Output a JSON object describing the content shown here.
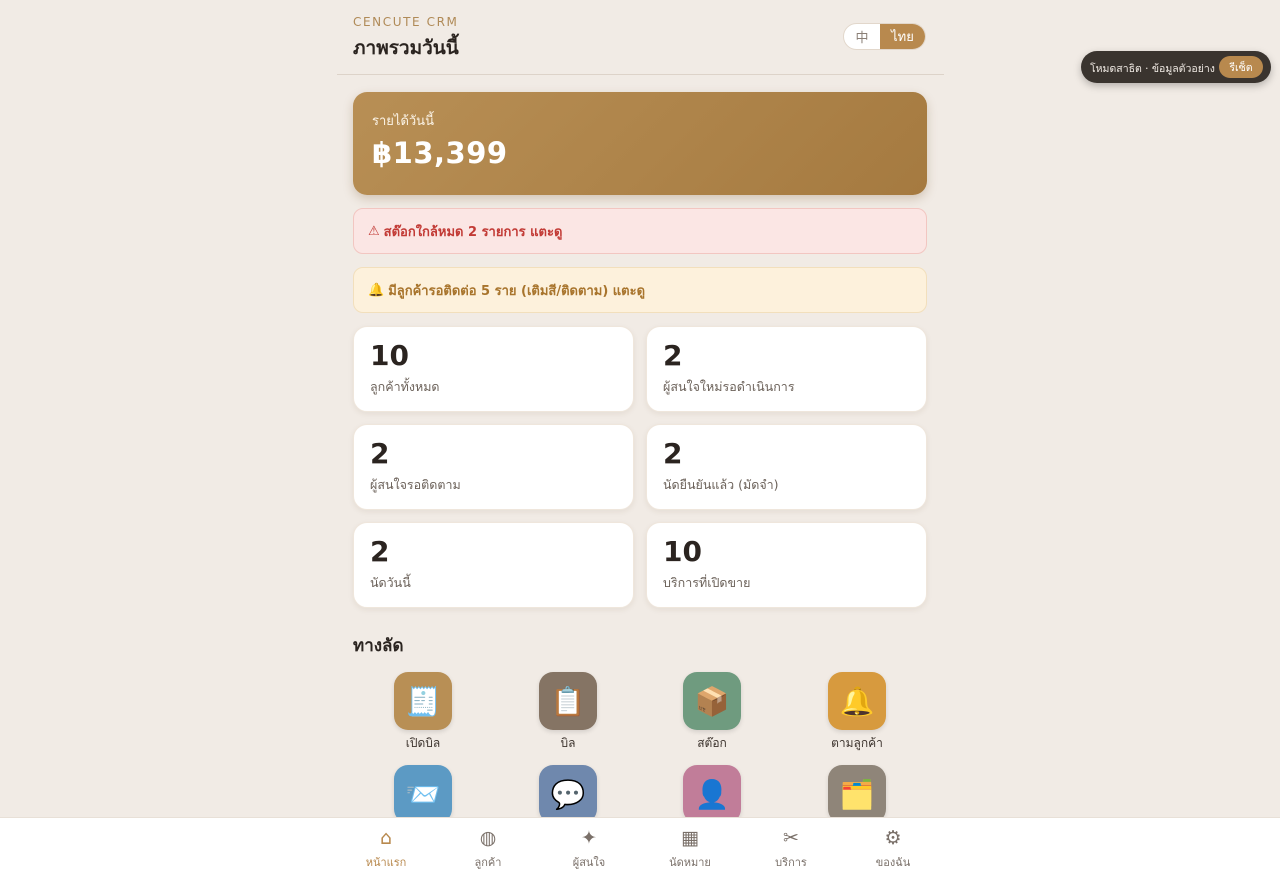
{
  "header": {
    "brand": "CENCUTE CRM",
    "title": "ภาพรวมวันนี้",
    "lang_options": [
      "中",
      "ไทย"
    ],
    "lang_active": "ไทย"
  },
  "revenue": {
    "label": "รายได้วันนี้",
    "value": "฿13,399"
  },
  "alerts": {
    "stock": {
      "icon": "⚠",
      "text": "สต๊อกใกล้หมด 2 รายการ แตะดู"
    },
    "follow": {
      "icon": "🔔",
      "text": "มีลูกค้ารอติดต่อ 5 ราย (เติมสี/ติดตาม) แตะดู"
    }
  },
  "stats": [
    {
      "value": "10",
      "label": "ลูกค้าทั้งหมด"
    },
    {
      "value": "2",
      "label": "ผู้สนใจใหม่รอดำเนินการ"
    },
    {
      "value": "2",
      "label": "ผู้สนใจรอติดตาม"
    },
    {
      "value": "2",
      "label": "นัดยืนยันแล้ว (มัดจำ)"
    },
    {
      "value": "2",
      "label": "นัดวันนี้"
    },
    {
      "value": "10",
      "label": "บริการที่เปิดขาย"
    }
  ],
  "shortcuts": {
    "title": "ทางลัด",
    "items": [
      {
        "label": "เปิดบิล",
        "icon": "receipt-icon",
        "glyph": "🧾",
        "color": "#b88f55"
      },
      {
        "label": "บิล",
        "icon": "clipboard-icon",
        "glyph": "📋",
        "color": "#857464"
      },
      {
        "label": "สต๊อก",
        "icon": "package-icon",
        "glyph": "📦",
        "color": "#6f9b7f"
      },
      {
        "label": "ตามลูกค้า",
        "icon": "bell-icon",
        "glyph": "🔔",
        "color": "#d79a3e"
      },
      {
        "label": "",
        "icon": "mail-icon",
        "glyph": "📨",
        "color": "#5c9ac4"
      },
      {
        "label": "",
        "icon": "chat-icon",
        "glyph": "💬",
        "color": "#6f88ad"
      },
      {
        "label": "",
        "icon": "user-icon",
        "glyph": "👤",
        "color": "#c17d99"
      },
      {
        "label": "",
        "icon": "card-box-icon",
        "glyph": "🗂️",
        "color": "#8f8579"
      }
    ]
  },
  "nav": [
    {
      "label": "หน้าแรก",
      "icon": "home-icon",
      "glyph": "⌂",
      "active": true
    },
    {
      "label": "ลูกค้า",
      "icon": "customers-icon",
      "glyph": "◍",
      "active": false
    },
    {
      "label": "ผู้สนใจ",
      "icon": "sparkle-icon",
      "glyph": "✦",
      "active": false
    },
    {
      "label": "นัดหมาย",
      "icon": "calendar-icon",
      "glyph": "▦",
      "active": false
    },
    {
      "label": "บริการ",
      "icon": "scissors-icon",
      "glyph": "✂",
      "active": false
    },
    {
      "label": "ของฉัน",
      "icon": "gear-icon",
      "glyph": "⚙",
      "active": false
    }
  ],
  "demo": {
    "text": "โหมดสาธิต · ข้อมูลตัวอย่าง",
    "reset_label": "รีเซ็ต"
  },
  "colors": {
    "accent": "#b8894e",
    "background": "#f1ebe5"
  }
}
